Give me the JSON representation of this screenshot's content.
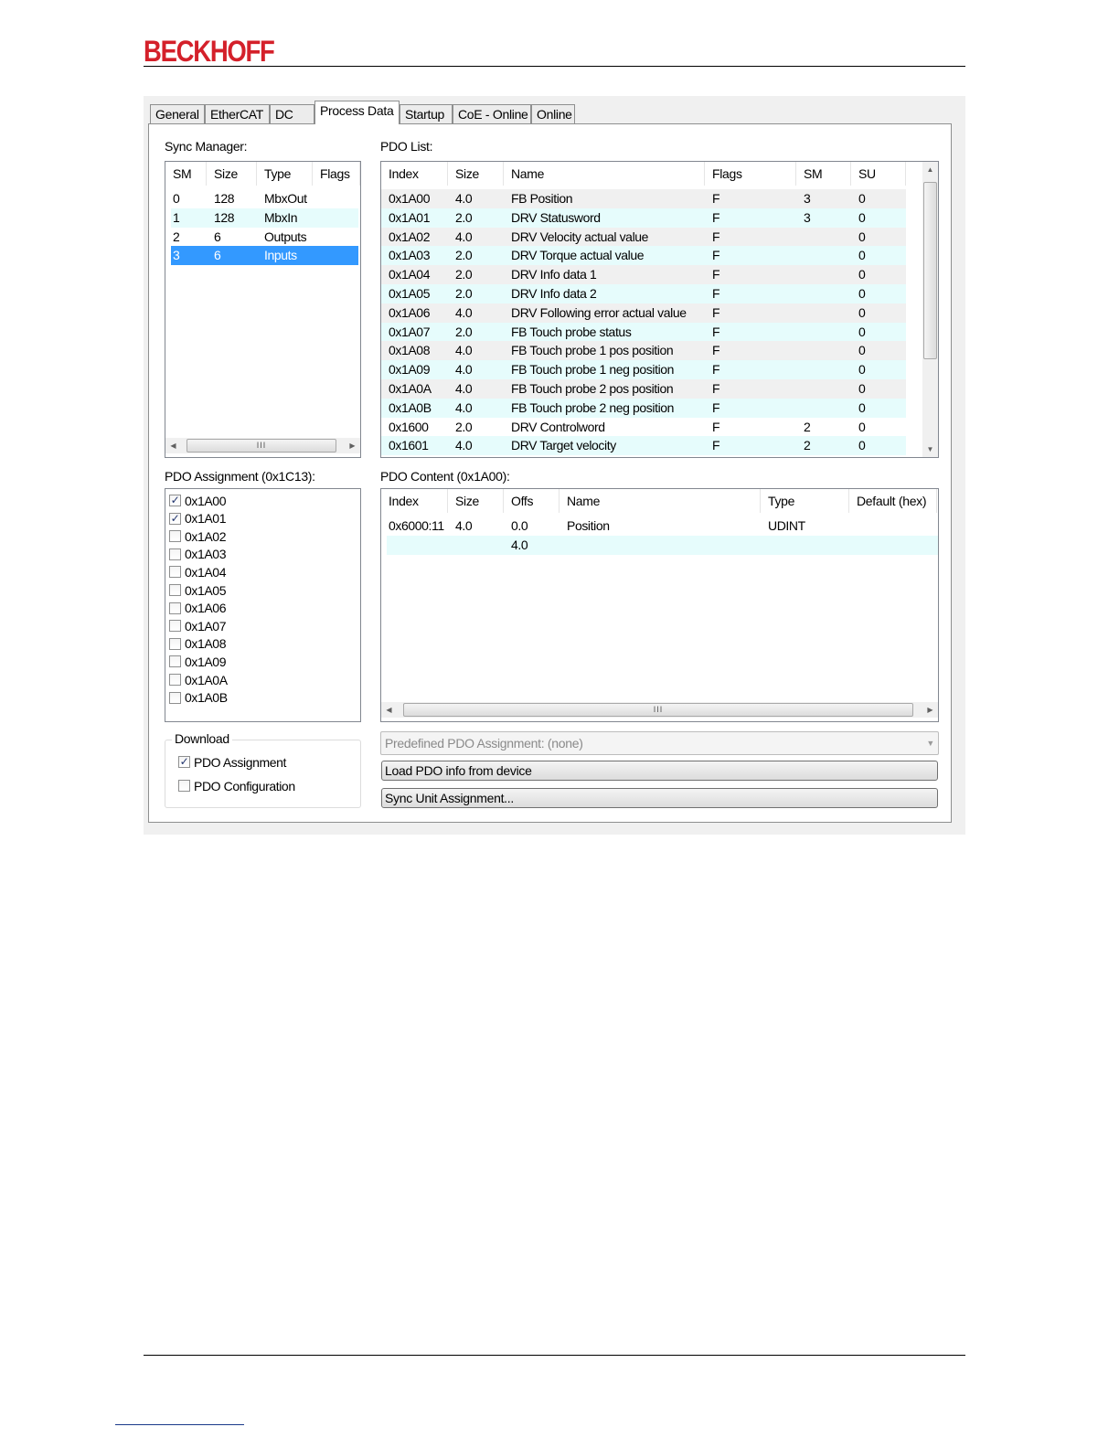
{
  "brand": {
    "logo_text": "BECKHOFF",
    "color": "#d4202a"
  },
  "tabs": [
    {
      "label": "General"
    },
    {
      "label": "EtherCAT"
    },
    {
      "label": "DC"
    },
    {
      "label": "Process Data",
      "active": true
    },
    {
      "label": "Startup"
    },
    {
      "label": "CoE - Online"
    },
    {
      "label": "Online"
    }
  ],
  "sync_manager": {
    "label": "Sync Manager:",
    "columns": [
      "SM",
      "Size",
      "Type",
      "Flags"
    ],
    "rows": [
      [
        "0",
        "128",
        "MbxOut",
        ""
      ],
      [
        "1",
        "128",
        "MbxIn",
        ""
      ],
      [
        "2",
        "6",
        "Outputs",
        ""
      ],
      [
        "3",
        "6",
        "Inputs",
        ""
      ]
    ],
    "selected_index": 3
  },
  "pdo_list": {
    "label": "PDO List:",
    "columns": [
      "Index",
      "Size",
      "Name",
      "Flags",
      "SM",
      "SU"
    ],
    "rows": [
      [
        "0x1A00",
        "4.0",
        "FB Position",
        "F",
        "3",
        "0"
      ],
      [
        "0x1A01",
        "2.0",
        "DRV Statusword",
        "F",
        "3",
        "0"
      ],
      [
        "0x1A02",
        "4.0",
        "DRV Velocity actual value",
        "F",
        "",
        "0"
      ],
      [
        "0x1A03",
        "2.0",
        "DRV Torque actual value",
        "F",
        "",
        "0"
      ],
      [
        "0x1A04",
        "2.0",
        "DRV Info data 1",
        "F",
        "",
        "0"
      ],
      [
        "0x1A05",
        "2.0",
        "DRV Info data 2",
        "F",
        "",
        "0"
      ],
      [
        "0x1A06",
        "4.0",
        "DRV Following error actual value",
        "F",
        "",
        "0"
      ],
      [
        "0x1A07",
        "2.0",
        "FB Touch probe status",
        "F",
        "",
        "0"
      ],
      [
        "0x1A08",
        "4.0",
        "FB Touch probe 1 pos position",
        "F",
        "",
        "0"
      ],
      [
        "0x1A09",
        "4.0",
        "FB Touch probe 1 neg position",
        "F",
        "",
        "0"
      ],
      [
        "0x1A0A",
        "4.0",
        "FB Touch probe 2 pos position",
        "F",
        "",
        "0"
      ],
      [
        "0x1A0B",
        "4.0",
        "FB Touch probe 2 neg position",
        "F",
        "",
        "0"
      ],
      [
        "0x1600",
        "2.0",
        "DRV Controlword",
        "F",
        "2",
        "0"
      ],
      [
        "0x1601",
        "4.0",
        "DRV Target velocity",
        "F",
        "2",
        "0"
      ]
    ]
  },
  "pdo_assignment": {
    "label": "PDO Assignment (0x1C13):",
    "items": [
      {
        "label": "0x1A00",
        "checked": true
      },
      {
        "label": "0x1A01",
        "checked": true
      },
      {
        "label": "0x1A02",
        "checked": false
      },
      {
        "label": "0x1A03",
        "checked": false
      },
      {
        "label": "0x1A04",
        "checked": false
      },
      {
        "label": "0x1A05",
        "checked": false
      },
      {
        "label": "0x1A06",
        "checked": false
      },
      {
        "label": "0x1A07",
        "checked": false
      },
      {
        "label": "0x1A08",
        "checked": false
      },
      {
        "label": "0x1A09",
        "checked": false
      },
      {
        "label": "0x1A0A",
        "checked": false
      },
      {
        "label": "0x1A0B",
        "checked": false
      }
    ]
  },
  "pdo_content": {
    "label": "PDO Content (0x1A00):",
    "columns": [
      "Index",
      "Size",
      "Offs",
      "Name",
      "Type",
      "Default (hex)"
    ],
    "rows": [
      [
        "0x6000:11",
        "4.0",
        "0.0",
        "Position",
        "UDINT",
        ""
      ],
      [
        "",
        "",
        "4.0",
        "",
        "",
        ""
      ]
    ]
  },
  "download": {
    "label": "Download",
    "pdo_assignment": {
      "label": "PDO Assignment",
      "checked": true
    },
    "pdo_configuration": {
      "label": "PDO Configuration",
      "checked": false
    }
  },
  "predefined": {
    "value": "Predefined PDO Assignment: (none)"
  },
  "buttons": {
    "load_pdo": "Load PDO info from device",
    "sync_unit": "Sync Unit Assignment..."
  },
  "scroll_thumb_glyph": "III",
  "check_glyph": "✓"
}
